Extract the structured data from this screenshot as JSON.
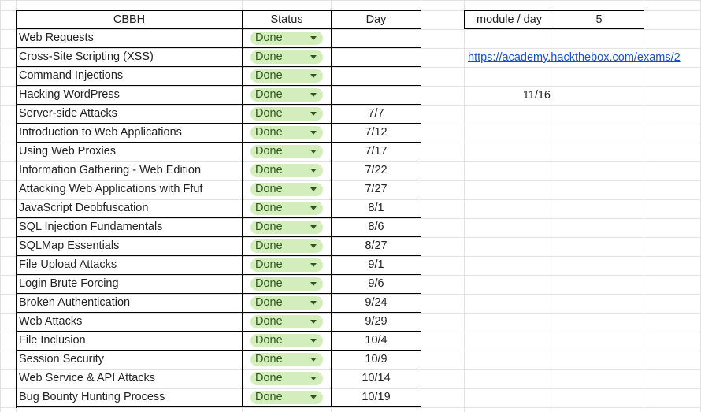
{
  "table": {
    "headers": {
      "name": "CBBH",
      "status": "Status",
      "day": "Day"
    },
    "rows": [
      {
        "name": "Web Requests",
        "status": "Done",
        "day": ""
      },
      {
        "name": "Cross-Site Scripting (XSS)",
        "status": "Done",
        "day": ""
      },
      {
        "name": "Command Injections",
        "status": "Done",
        "day": ""
      },
      {
        "name": "Hacking WordPress",
        "status": "Done",
        "day": ""
      },
      {
        "name": "Server-side Attacks",
        "status": "Done",
        "day": "7/7"
      },
      {
        "name": "Introduction to Web Applications",
        "status": "Done",
        "day": "7/12"
      },
      {
        "name": "Using Web Proxies",
        "status": "Done",
        "day": "7/17"
      },
      {
        "name": "Information Gathering - Web Edition",
        "status": "Done",
        "day": "7/22"
      },
      {
        "name": "Attacking Web Applications with Ffuf",
        "status": "Done",
        "day": "7/27"
      },
      {
        "name": "JavaScript Deobfuscation",
        "status": "Done",
        "day": "8/1"
      },
      {
        "name": "SQL Injection Fundamentals",
        "status": "Done",
        "day": "8/6"
      },
      {
        "name": "SQLMap Essentials",
        "status": "Done",
        "day": "8/27"
      },
      {
        "name": "File Upload Attacks",
        "status": "Done",
        "day": "9/1"
      },
      {
        "name": "Login Brute Forcing",
        "status": "Done",
        "day": "9/6"
      },
      {
        "name": "Broken Authentication",
        "status": "Done",
        "day": "9/24"
      },
      {
        "name": "Web Attacks",
        "status": "Done",
        "day": "9/29"
      },
      {
        "name": "File Inclusion",
        "status": "Done",
        "day": "10/4"
      },
      {
        "name": "Session Security",
        "status": "Done",
        "day": "10/9"
      },
      {
        "name": "Web Service & API Attacks",
        "status": "Done",
        "day": "10/14"
      },
      {
        "name": "Bug Bounty Hunting Process",
        "status": "Done",
        "day": "10/19"
      }
    ]
  },
  "side": {
    "module_per_day_label": "module / day",
    "module_per_day_value": "5",
    "exam_link": "https://academy.hackthebox.com/exams/2",
    "date": "11/16"
  },
  "colors": {
    "chip_background": "#d4edbc",
    "chip_text": "#2f5a1a",
    "link": "#1155cc"
  }
}
